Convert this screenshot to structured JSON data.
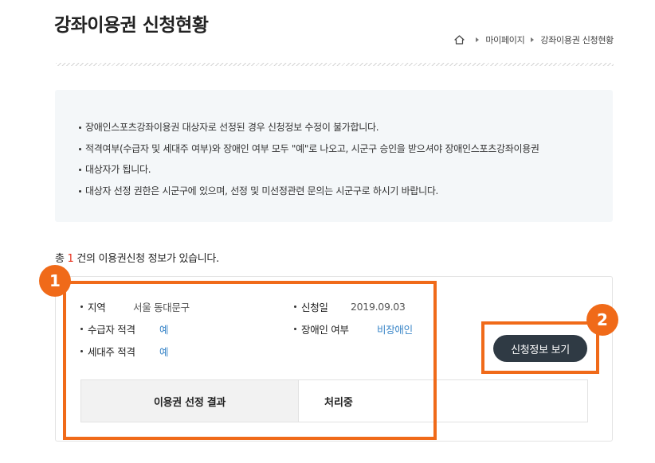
{
  "page_title": "강좌이용권 신청현황",
  "breadcrumb": {
    "items": [
      "마이페이지",
      "강좌이용권 신청현황"
    ]
  },
  "notice": {
    "items": [
      "장애인스포츠강좌이용권 대상자로 선정된 경우 신청정보 수정이 불가합니다.",
      "적격여부(수급자 및 세대주 여부)와 장애인 여부 모두 \"예\"로 나오고, 시군구 승인을 받으셔야 장애인스포츠강좌이용권",
      "대상자가 됩니다.",
      "대상자 선정 권한은 시군구에 있으며, 선정 및 미선정관련 문의는 시군구로 하시기 바랍니다."
    ]
  },
  "summary": {
    "prefix": "총",
    "count": "1",
    "suffix": "건의 이용권신청 정보가 있습니다."
  },
  "application": {
    "region_label": "지역",
    "region_value": "서울 동대문구",
    "recipient_label": "수급자 적격",
    "recipient_value": "예",
    "householder_label": "세대주 적격",
    "householder_value": "예",
    "date_label": "신청일",
    "date_value": "2019.09.03",
    "disability_label": "장애인 여부",
    "disability_value": "비장애인",
    "view_button_label": "신청정보 보기",
    "result_header": "이용권 선정 결과",
    "result_value": "처리중"
  },
  "annotations": {
    "badge_1": "1",
    "badge_2": "2",
    "color": "#f06a19"
  },
  "colors": {
    "accent_red": "#e8321e",
    "link_blue": "#3a86c8",
    "button_dark": "#2f3a44",
    "notice_bg": "#f4f7f9"
  }
}
